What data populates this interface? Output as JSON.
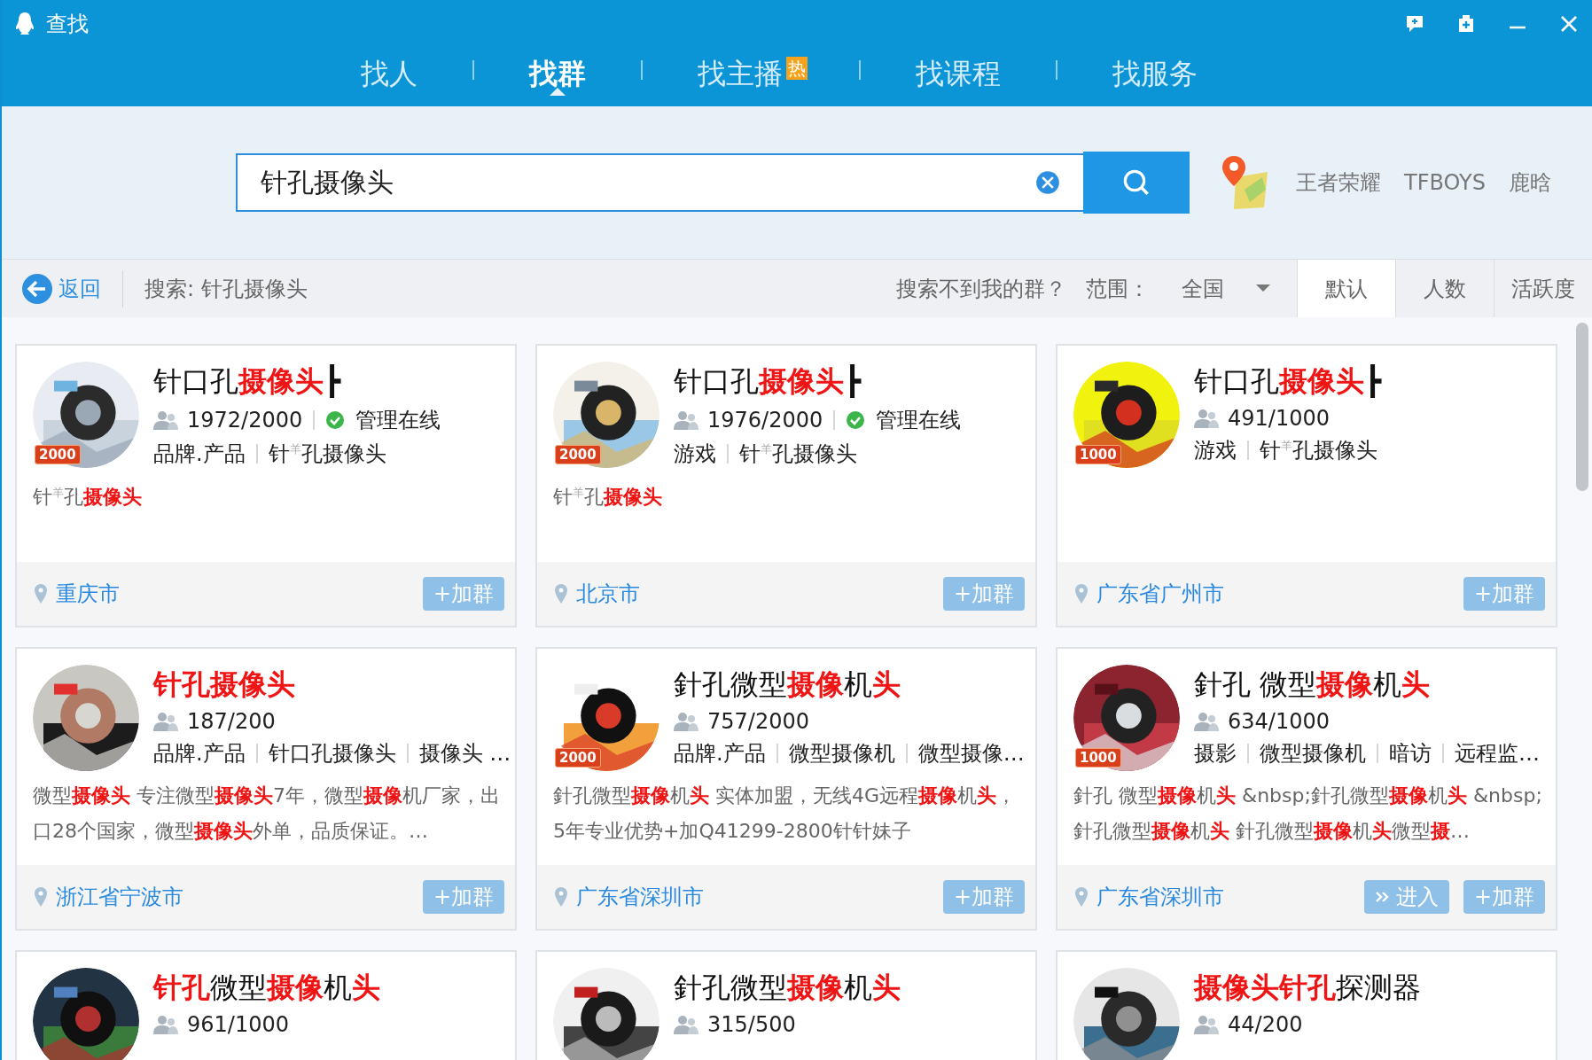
{
  "window": {
    "title": "查找"
  },
  "nav": [
    {
      "label": "找人",
      "selected": false
    },
    {
      "label": "找群",
      "selected": true
    },
    {
      "label": "找主播",
      "selected": false,
      "badge": "热"
    },
    {
      "label": "找课程",
      "selected": false
    },
    {
      "label": "找服务",
      "selected": false
    }
  ],
  "search": {
    "value": "针孔摄像头",
    "hot_words": [
      "王者荣耀",
      "TFBOYS",
      "鹿晗"
    ]
  },
  "toolbar": {
    "back": "返回",
    "query": "搜索: 针孔摄像头",
    "help": "搜索不到我的群？",
    "range_label": "范围：",
    "range_value": "全国",
    "sorts": [
      {
        "label": "默认",
        "selected": true
      },
      {
        "label": "人数",
        "selected": false
      },
      {
        "label": "活跃度",
        "selected": false
      }
    ]
  },
  "groups": [
    {
      "title": "针口孔**摄像头**┣",
      "badge": "2000",
      "members": "1972/2000",
      "status": "管理在线",
      "tags": [
        "品牌.产品",
        "针$^{羊}$孔摄像头"
      ],
      "description": "针$^{羊}$孔**摄像头**",
      "location": "重庆市",
      "buttons": [
        {
          "kind": "join",
          "label": "+加群"
        }
      ]
    },
    {
      "title": "针口孔**摄像头**┣",
      "badge": "2000",
      "members": "1976/2000",
      "status": "管理在线",
      "tags": [
        "游戏",
        "针$^{羊}$孔摄像头"
      ],
      "description": "针$^{羊}$孔**摄像头**",
      "location": "北京市",
      "buttons": [
        {
          "kind": "join",
          "label": "+加群"
        }
      ]
    },
    {
      "title": "针口孔**摄像头**┣",
      "badge": "1000",
      "members": "491/1000",
      "tags": [
        "游戏",
        "针$^{羊}$孔摄像头"
      ],
      "location": "广东省广州市",
      "buttons": [
        {
          "kind": "join",
          "label": "+加群"
        }
      ]
    },
    {
      "title": "**针孔摄像头**",
      "members": "187/200",
      "tags": [
        "品牌.产品",
        "针口孔摄像头",
        "摄像头 …"
      ],
      "description": "微型**摄像头** 专注微型**摄像头**7年，微型**摄像**机厂家，出口28个国家，微型**摄像头**外单，品质保证。…",
      "location": "浙江省宁波市",
      "buttons": [
        {
          "kind": "join",
          "label": "+加群"
        }
      ]
    },
    {
      "title": "針孔微型**摄像**机**头**",
      "badge": "2000",
      "members": "757/2000",
      "tags": [
        "品牌.产品",
        "微型摄像机",
        "微型摄像…"
      ],
      "description": "針孔微型**摄像**机**头** 实体加盟，无线4G远程**摄像**机**头**，5年专业优势+加Q41299-2800针针妹子",
      "location": "广东省深圳市",
      "buttons": [
        {
          "kind": "join",
          "label": "+加群"
        }
      ]
    },
    {
      "title": "針孔 微型**摄像**机**头**",
      "badge": "1000",
      "members": "634/1000",
      "tags": [
        "摄影",
        "微型摄像机",
        "暗访",
        "远程监…"
      ],
      "description": "針孔 微型**摄像**机**头** &nbsp;針孔微型**摄像**机**头** &nbsp;針孔微型**摄像**机**头** 針孔微型**摄像**机**头**微型**摄**…",
      "location": "广东省深圳市",
      "buttons": [
        {
          "kind": "enter",
          "label": "进入"
        },
        {
          "kind": "join",
          "label": "+加群"
        }
      ]
    },
    {
      "title": "**针孔**微型**摄像**机**头**",
      "members": "961/1000"
    },
    {
      "title": "針孔微型**摄像**机**头**",
      "members": "315/500"
    },
    {
      "title": "**摄像头针孔**探测器",
      "members": "44/200"
    }
  ]
}
